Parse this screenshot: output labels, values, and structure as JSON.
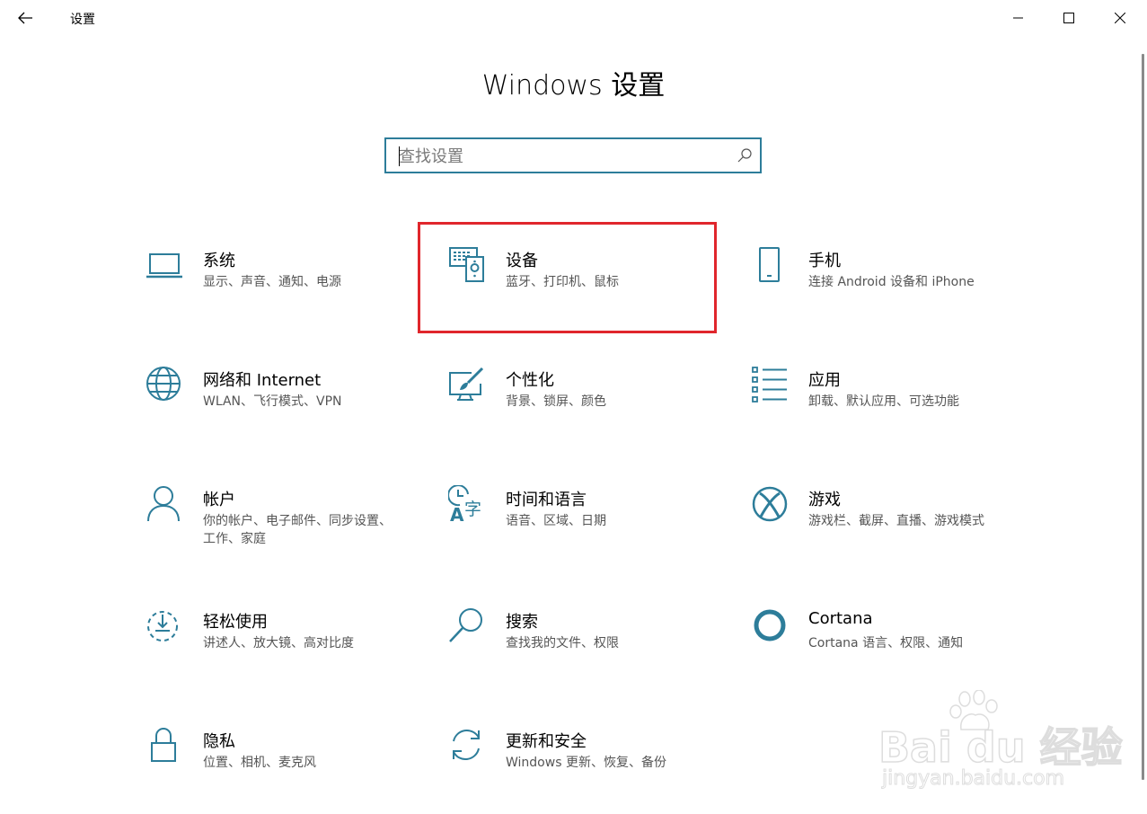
{
  "window": {
    "title": "设置",
    "back_label": "←"
  },
  "page": {
    "title": "Windows 设置"
  },
  "search": {
    "placeholder": "查找设置",
    "value": ""
  },
  "tiles": [
    {
      "name": "系统",
      "desc": "显示、声音、通知、电源",
      "icon": "laptop-icon"
    },
    {
      "name": "设备",
      "desc": "蓝牙、打印机、鼠标",
      "icon": "devices-icon"
    },
    {
      "name": "手机",
      "desc": "连接 Android 设备和 iPhone",
      "icon": "phone-icon"
    },
    {
      "name": "网络和 Internet",
      "desc": "WLAN、飞行模式、VPN",
      "icon": "globe-icon"
    },
    {
      "name": "个性化",
      "desc": "背景、锁屏、颜色",
      "icon": "personalization-icon"
    },
    {
      "name": "应用",
      "desc": "卸载、默认应用、可选功能",
      "icon": "apps-list-icon"
    },
    {
      "name": "帐户",
      "desc": "你的帐户、电子邮件、同步设置、工作、家庭",
      "icon": "person-icon"
    },
    {
      "name": "时间和语言",
      "desc": "语音、区域、日期",
      "icon": "time-language-icon"
    },
    {
      "name": "游戏",
      "desc": "游戏栏、截屏、直播、游戏模式",
      "icon": "xbox-icon"
    },
    {
      "name": "轻松使用",
      "desc": "讲述人、放大镜、高对比度",
      "icon": "ease-of-access-icon"
    },
    {
      "name": "搜索",
      "desc": "查找我的文件、权限",
      "icon": "search-magnifier-icon"
    },
    {
      "name": "Cortana",
      "desc": "Cortana 语言、权限、通知",
      "icon": "cortana-icon"
    },
    {
      "name": "隐私",
      "desc": "位置、相机、麦克风",
      "icon": "lock-icon"
    },
    {
      "name": "更新和安全",
      "desc": "Windows 更新、恢复、备份",
      "icon": "refresh-icon"
    }
  ],
  "highlighted_tile": "设备",
  "watermark": {
    "logo_text": "Bai du 经验",
    "url": "jingyan.baidu.com"
  },
  "colors": {
    "accent": "#2d7d9a",
    "highlight": "#e0262c"
  }
}
